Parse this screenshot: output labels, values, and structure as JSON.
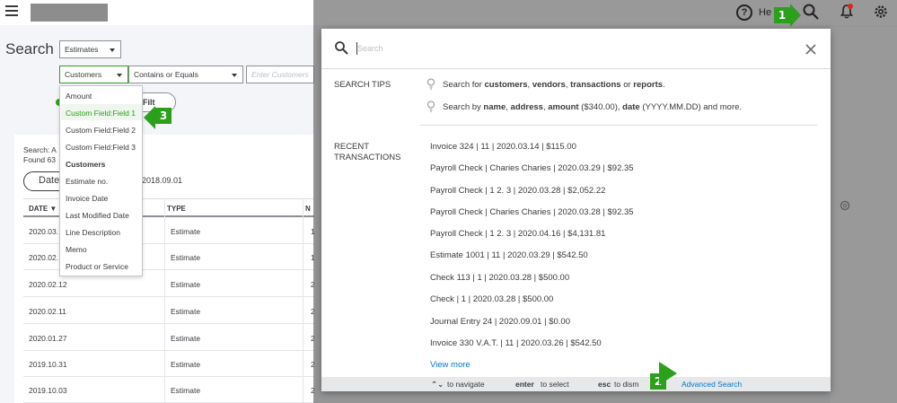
{
  "topbar": {
    "help_label": "He",
    "icons": [
      "menu-icon",
      "help-icon",
      "search-icon",
      "bell-icon",
      "gear-icon"
    ]
  },
  "page": {
    "title": "Search",
    "type_select": "Estimates",
    "field_select": "Customers",
    "operator_select": "Contains or Equals",
    "value_placeholder": "Enter Customers",
    "filter_button": "Filt",
    "summary_line1": "Search: A",
    "summary_line2": "Found 63",
    "date_pill": "Date",
    "date_range": "2018.09.01",
    "table": {
      "headers": [
        "DATE ▼",
        "TYPE",
        "N"
      ],
      "rows": [
        {
          "date": "2020.03.",
          "type": "Estimate",
          "n": "1"
        },
        {
          "date": "2020.02.",
          "type": "Estimate",
          "n": "1"
        },
        {
          "date": "2020.02.12",
          "type": "Estimate",
          "n": "2"
        },
        {
          "date": "2020.02.11",
          "type": "Estimate",
          "n": "2"
        },
        {
          "date": "2020.01.27",
          "type": "Estimate",
          "n": "2"
        },
        {
          "date": "2019.10.31",
          "type": "Estimate",
          "n": "2"
        },
        {
          "date": "2019.10.03",
          "type": "Estimate",
          "n": "2"
        }
      ]
    }
  },
  "dropdown": {
    "items": [
      {
        "label": "Amount",
        "bold": false,
        "selected": false
      },
      {
        "label": "Custom Field:Field 1",
        "bold": false,
        "selected": true
      },
      {
        "label": "Custom Field:Field 2",
        "bold": false,
        "selected": false
      },
      {
        "label": "Custom Field:Field 3",
        "bold": false,
        "selected": false
      },
      {
        "label": "Customers",
        "bold": true,
        "selected": false
      },
      {
        "label": "Estimate no.",
        "bold": false,
        "selected": false
      },
      {
        "label": "Invoice Date",
        "bold": false,
        "selected": false
      },
      {
        "label": "Last Modified Date",
        "bold": false,
        "selected": false
      },
      {
        "label": "Line Description",
        "bold": false,
        "selected": false
      },
      {
        "label": "Memo",
        "bold": false,
        "selected": false
      },
      {
        "label": "Product or Service",
        "bold": false,
        "selected": false
      }
    ]
  },
  "modal": {
    "search_placeholder": "Search",
    "tips_label": "SEARCH TIPS",
    "tip1": {
      "pre": "Search for ",
      "b1": "customers",
      "s1": ", ",
      "b2": "vendors",
      "s2": ", ",
      "b3": "transactions",
      "s3": " or ",
      "b4": "reports",
      "post": "."
    },
    "tip2": {
      "pre": "Search by ",
      "b1": "name",
      "s1": ", ",
      "b2": "address",
      "s2": ", ",
      "b3": "amount",
      "s3": " ($340.00), ",
      "b4": "date",
      "post": " (YYYY.MM.DD) and more."
    },
    "recent_label_1": "RECENT",
    "recent_label_2": "TRANSACTIONS",
    "recent": [
      "Invoice 324 | 11 | 2020.03.14 | $115.00",
      "Payroll Check  | Charies Charies | 2020.03.29 | $92.35",
      "Payroll Check  | 1 2. 3 | 2020.03.28 | $2,052.22",
      "Payroll Check  | Charies Charies | 2020.03.28 | $92.35",
      "Payroll Check  | 1 2. 3 | 2020.04.16 | $4,131.81",
      "Estimate 1001 | 11 | 2020.03.29 | $542.50",
      "Check 113 | 1 | 2020.03.28 | $500.00",
      "Check  | 1 | 2020.03.28 | $500.00",
      "Journal Entry 24 | 2020.09.01 | $0.00",
      "Invoice 330 V.A.T. | 11 | 2020.03.26 | $542.50"
    ],
    "view_more": "View more",
    "footer": {
      "nav_key": "⌃⌄",
      "nav_text": "to navigate",
      "enter_key": "enter",
      "enter_text": "to select",
      "esc_key": "esc",
      "esc_text": "to dism",
      "advanced": "Advanced Search"
    }
  },
  "callouts": [
    "1",
    "2",
    "3"
  ],
  "colors": {
    "accent_green": "#2ca01c",
    "link_blue": "#0077c5",
    "notification_red": "#d52b1e"
  }
}
